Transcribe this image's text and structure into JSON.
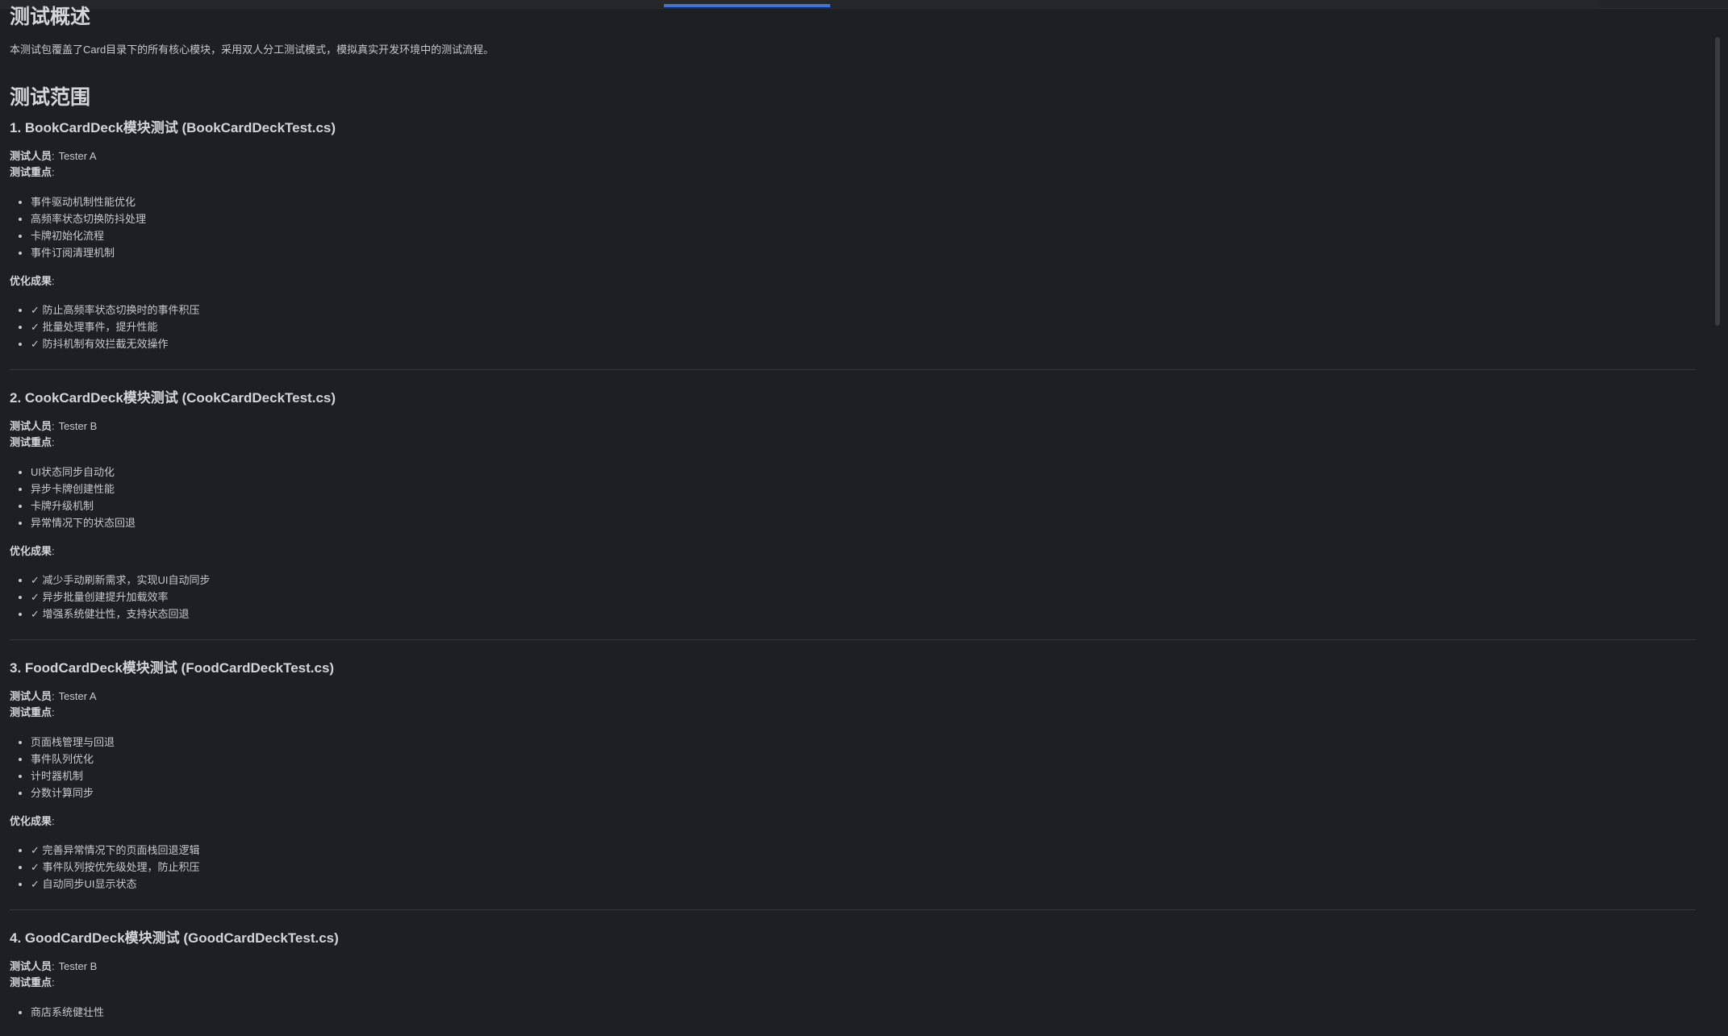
{
  "overview": {
    "title": "测试概述",
    "intro": "本测试包覆盖了Card目录下的所有核心模块，采用双人分工测试模式，模拟真实开发环境中的测试流程。"
  },
  "scope": {
    "title": "测试范围",
    "labels": {
      "tester": "测试人员",
      "focus": "测试重点",
      "results": "优化成果",
      "colon": ":"
    },
    "modules": [
      {
        "heading": "1. BookCardDeck模块测试 (BookCardDeckTest.cs)",
        "tester": "Tester A",
        "focus": [
          "事件驱动机制性能优化",
          "高频率状态切换防抖处理",
          "卡牌初始化流程",
          "事件订阅清理机制"
        ],
        "results": [
          "✓ 防止高频率状态切换时的事件积压",
          "✓ 批量处理事件，提升性能",
          "✓ 防抖机制有效拦截无效操作"
        ]
      },
      {
        "heading": "2. CookCardDeck模块测试 (CookCardDeckTest.cs)",
        "tester": "Tester B",
        "focus": [
          "UI状态同步自动化",
          "异步卡牌创建性能",
          "卡牌升级机制",
          "异常情况下的状态回退"
        ],
        "results": [
          "✓ 减少手动刷新需求，实现UI自动同步",
          "✓ 异步批量创建提升加载效率",
          "✓ 增强系统健壮性，支持状态回退"
        ]
      },
      {
        "heading": "3. FoodCardDeck模块测试 (FoodCardDeckTest.cs)",
        "tester": "Tester A",
        "focus": [
          "页面栈管理与回退",
          "事件队列优化",
          "计时器机制",
          "分数计算同步"
        ],
        "results": [
          "✓ 完善异常情况下的页面栈回退逻辑",
          "✓ 事件队列按优先级处理，防止积压",
          "✓ 自动同步UI显示状态"
        ]
      },
      {
        "heading": "4. GoodCardDeck模块测试 (GoodCardDeckTest.cs)",
        "tester": "Tester B",
        "focus": [
          "商店系统健壮性"
        ],
        "results": []
      }
    ]
  }
}
